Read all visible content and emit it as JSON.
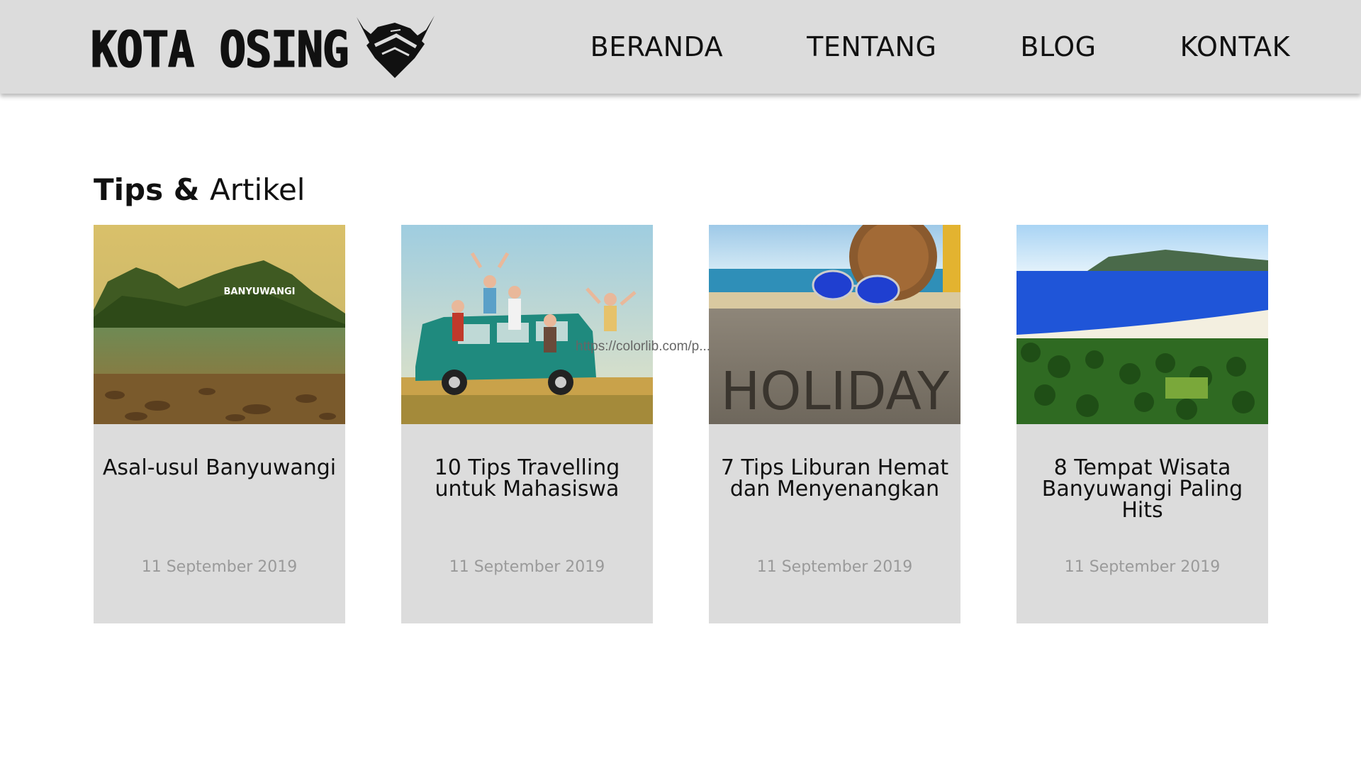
{
  "header": {
    "logo_text": "KOTA OSING",
    "nav": [
      {
        "label": "BERANDA"
      },
      {
        "label": "TENTANG"
      },
      {
        "label": "BLOG"
      },
      {
        "label": "KONTAK"
      }
    ]
  },
  "section": {
    "title_strong": "Tips &",
    "title_light": "Artikel"
  },
  "image_text": {
    "banyuwangi": "BANYUWANGI",
    "holiday": "HOLIDAY"
  },
  "cards": [
    {
      "title": "Asal-usul Banyuwangi",
      "date": "11 September 2019"
    },
    {
      "title": "10 Tips Travelling untuk Mahasiswa",
      "date": "11 September 2019"
    },
    {
      "title": "7 Tips Liburan Hemat dan Menyenangkan",
      "date": "11 September 2019"
    },
    {
      "title": "8 Tempat Wisata Banyuwangi Paling Hits",
      "date": "11 September 2019"
    }
  ],
  "url_overlay": "https://colorlib.com/p...",
  "colors": {
    "header_bg": "#dcdcdc",
    "card_bg": "#dcdcdc",
    "date_text": "#9a9a9a",
    "text": "#111111"
  }
}
